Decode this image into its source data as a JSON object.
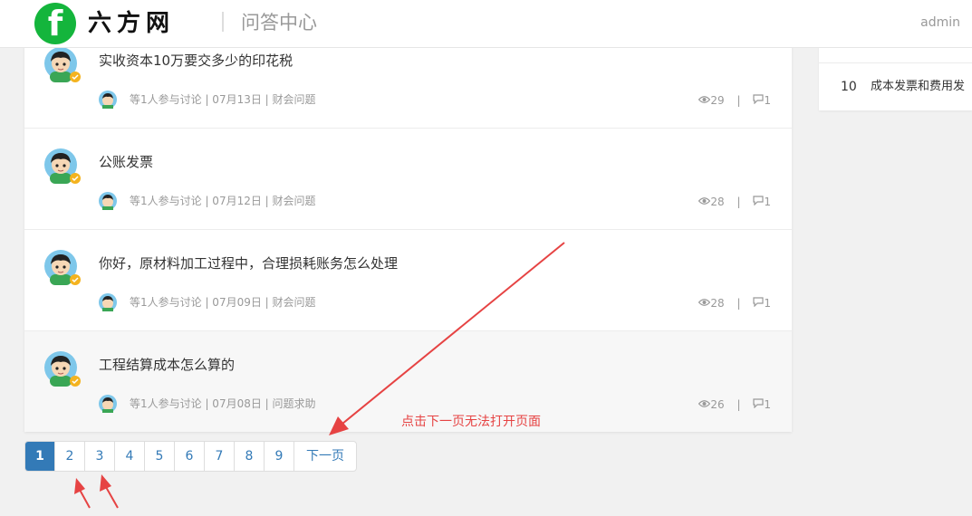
{
  "header": {
    "logo_letter": "f",
    "brand": "六方网",
    "section": "问答中心",
    "user": "admin"
  },
  "side_panel": {
    "items": [
      {
        "rank": "10",
        "text": "成本发票和费用发"
      }
    ]
  },
  "questions": [
    {
      "title": "实收资本10万要交多少的印花税",
      "meta": "等1人参与讨论 | 07月13日 | 财会问题",
      "views": "29",
      "answers": "1"
    },
    {
      "title": "公账发票",
      "meta": "等1人参与讨论 | 07月12日 | 财会问题",
      "views": "28",
      "answers": "1"
    },
    {
      "title": "你好，原材料加工过程中，合理损耗账务怎么处理",
      "meta": "等1人参与讨论 | 07月09日 | 财会问题",
      "views": "28",
      "answers": "1"
    },
    {
      "title": "工程结算成本怎么算的",
      "meta": "等1人参与讨论 | 07月08日 | 问题求助",
      "views": "26",
      "answers": "1"
    }
  ],
  "stat_separator": "|",
  "pagination": {
    "pages": [
      "1",
      "2",
      "3",
      "4",
      "5",
      "6",
      "7",
      "8",
      "9"
    ],
    "active": "1",
    "next": "下一页"
  },
  "annotation": {
    "text": "点击下一页无法打开页面",
    "color": "#e64343"
  },
  "colors": {
    "brand_green": "#14b53c",
    "link_blue": "#337ab7"
  },
  "icons": [
    "eye-icon",
    "comment-icon",
    "user-avatar",
    "vip-badge-icon"
  ]
}
